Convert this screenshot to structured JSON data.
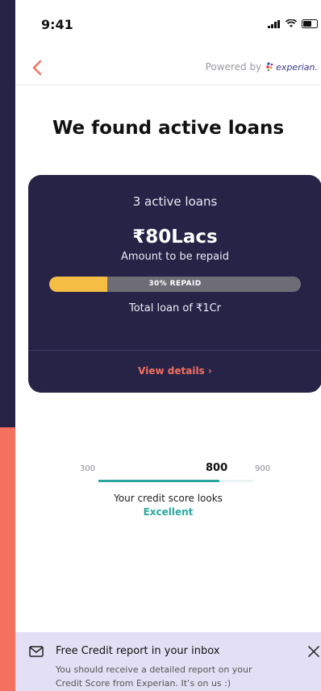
{
  "status_bar": {
    "time": "9:41"
  },
  "header": {
    "powered_by": "Powered by",
    "brand": "experian."
  },
  "page": {
    "title": "We found active loans"
  },
  "loan_card": {
    "count_text": "3 active loans",
    "amount": "₹80Lacs",
    "amount_label": "Amount to be repaid",
    "repaid_fraction": 0.23,
    "repaid_label": "30% REPAID",
    "total_text": "Total loan of ₹1Cr",
    "view_details": "View details ›"
  },
  "credit_score": {
    "min": "300",
    "value": "800",
    "max": "900",
    "fill_fraction": 0.78,
    "text": "Your credit score looks",
    "rating": "Excellent"
  },
  "banner": {
    "title": "Free Credit report in your inbox",
    "body": "You should receive a detailed report on your Credit Score from Experian. It’s on us :)"
  },
  "colors": {
    "accent": "#f4715f",
    "card": "#262347",
    "progress": "#f5bd43",
    "score": "#29a79c"
  }
}
